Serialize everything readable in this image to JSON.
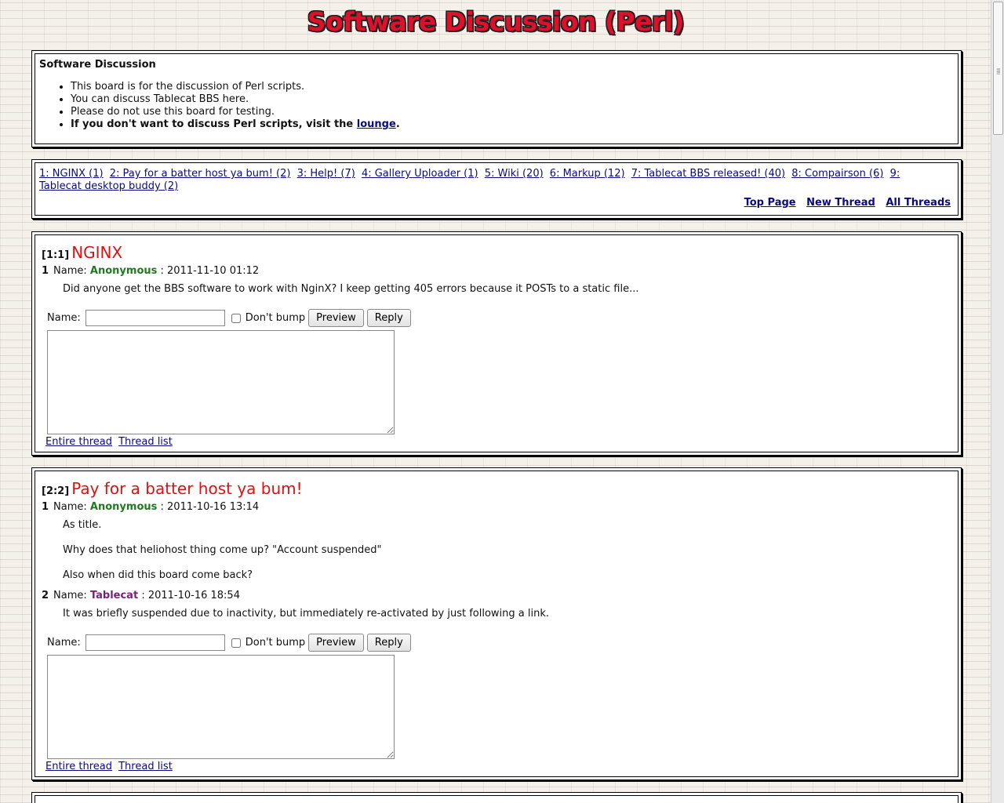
{
  "board": {
    "title": "Software Discussion (Perl)"
  },
  "header": {
    "heading": "Software Discussion",
    "rules": [
      "This board is for the discussion of Perl scripts.",
      "You can discuss Tablecat BBS here.",
      "Please do not use this board for testing."
    ],
    "lounge_prefix": "If you don't want to discuss Perl scripts, visit the ",
    "lounge_link": "lounge",
    "lounge_suffix": "."
  },
  "thread_list": [
    "1: NGINX (1)",
    "2: Pay for a batter host ya bum! (2)",
    "3: Help! (7)",
    "4: Gallery Uploader (1)",
    "5: Wiki (20)",
    "6: Markup (12)",
    "7: Tablecat BBS released! (40)",
    "8: Compairson (6)",
    "9: Tablecat desktop buddy (2)"
  ],
  "nav": {
    "top_page": "Top Page",
    "new_thread": "New Thread",
    "all_threads": "All Threads"
  },
  "threads": [
    {
      "index": "[1:1]",
      "subject": "NGINX",
      "posts": [
        {
          "num": "1",
          "name_label": "Name:",
          "poster": "Anonymous",
          "date": ": 2011-11-10 01:12",
          "body": [
            "Did anyone get the BBS software to work with NginX? I keep getting 405 errors because it POSTs to a static file..."
          ]
        }
      ]
    },
    {
      "index": "[2:2]",
      "subject": "Pay for a batter host ya bum!",
      "posts": [
        {
          "num": "1",
          "name_label": "Name:",
          "poster": "Anonymous",
          "date": ": 2011-10-16 13:14",
          "body": [
            "As title.",
            "Why does that heliohost thing come up? \"Account suspended\"",
            "Also when did this board come back?"
          ]
        },
        {
          "num": "2",
          "name_label": "Name:",
          "poster": "Tablecat",
          "date": ": 2011-10-16 18:54",
          "body": [
            "It was briefly suspended due to inactivity, but immediately re-activated by just following a link."
          ]
        }
      ]
    }
  ],
  "reply_form": {
    "name_label": "Name:",
    "name_value": "",
    "dont_bump_label": "Don't bump",
    "preview_label": "Preview",
    "reply_label": "Reply"
  },
  "thread_links": {
    "entire_thread": "Entire thread",
    "thread_list": "Thread list"
  },
  "colors": {
    "title_red": "#e0102a",
    "anonymous_green": "#1f7a1f",
    "tablecat_purple": "#7a1f7a",
    "link_blue": "#0a0a80"
  }
}
